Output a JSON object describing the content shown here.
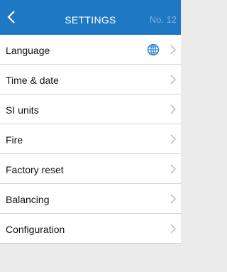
{
  "header": {
    "title": "SETTINGS",
    "number": "No. 12",
    "back_icon": "chevron-left-icon",
    "colors": {
      "bar": "#1f78c4",
      "number": "#7bb1e0"
    }
  },
  "menu": {
    "items": [
      {
        "label": "Language",
        "icon": "globe-icon"
      },
      {
        "label": "Time & date"
      },
      {
        "label": "SI units"
      },
      {
        "label": "Fire"
      },
      {
        "label": "Factory reset"
      },
      {
        "label": "Balancing"
      },
      {
        "label": "Configuration"
      }
    ],
    "chevron_icon": "chevron-right-icon"
  }
}
